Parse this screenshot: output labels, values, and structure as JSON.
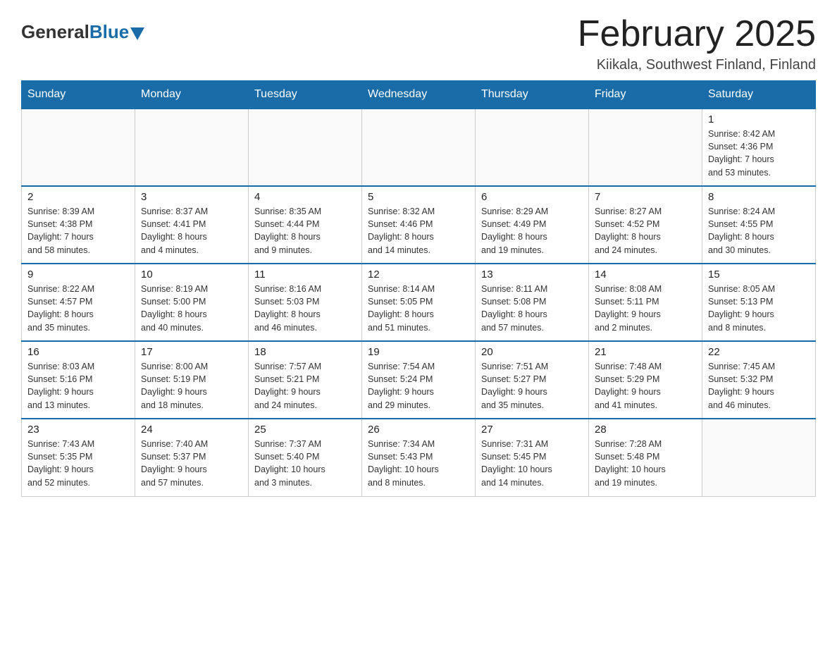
{
  "logo": {
    "general": "General",
    "blue": "Blue"
  },
  "title": {
    "month": "February 2025",
    "location": "Kiikala, Southwest Finland, Finland"
  },
  "weekdays": [
    "Sunday",
    "Monday",
    "Tuesday",
    "Wednesday",
    "Thursday",
    "Friday",
    "Saturday"
  ],
  "weeks": [
    [
      {
        "day": "",
        "info": ""
      },
      {
        "day": "",
        "info": ""
      },
      {
        "day": "",
        "info": ""
      },
      {
        "day": "",
        "info": ""
      },
      {
        "day": "",
        "info": ""
      },
      {
        "day": "",
        "info": ""
      },
      {
        "day": "1",
        "info": "Sunrise: 8:42 AM\nSunset: 4:36 PM\nDaylight: 7 hours\nand 53 minutes."
      }
    ],
    [
      {
        "day": "2",
        "info": "Sunrise: 8:39 AM\nSunset: 4:38 PM\nDaylight: 7 hours\nand 58 minutes."
      },
      {
        "day": "3",
        "info": "Sunrise: 8:37 AM\nSunset: 4:41 PM\nDaylight: 8 hours\nand 4 minutes."
      },
      {
        "day": "4",
        "info": "Sunrise: 8:35 AM\nSunset: 4:44 PM\nDaylight: 8 hours\nand 9 minutes."
      },
      {
        "day": "5",
        "info": "Sunrise: 8:32 AM\nSunset: 4:46 PM\nDaylight: 8 hours\nand 14 minutes."
      },
      {
        "day": "6",
        "info": "Sunrise: 8:29 AM\nSunset: 4:49 PM\nDaylight: 8 hours\nand 19 minutes."
      },
      {
        "day": "7",
        "info": "Sunrise: 8:27 AM\nSunset: 4:52 PM\nDaylight: 8 hours\nand 24 minutes."
      },
      {
        "day": "8",
        "info": "Sunrise: 8:24 AM\nSunset: 4:55 PM\nDaylight: 8 hours\nand 30 minutes."
      }
    ],
    [
      {
        "day": "9",
        "info": "Sunrise: 8:22 AM\nSunset: 4:57 PM\nDaylight: 8 hours\nand 35 minutes."
      },
      {
        "day": "10",
        "info": "Sunrise: 8:19 AM\nSunset: 5:00 PM\nDaylight: 8 hours\nand 40 minutes."
      },
      {
        "day": "11",
        "info": "Sunrise: 8:16 AM\nSunset: 5:03 PM\nDaylight: 8 hours\nand 46 minutes."
      },
      {
        "day": "12",
        "info": "Sunrise: 8:14 AM\nSunset: 5:05 PM\nDaylight: 8 hours\nand 51 minutes."
      },
      {
        "day": "13",
        "info": "Sunrise: 8:11 AM\nSunset: 5:08 PM\nDaylight: 8 hours\nand 57 minutes."
      },
      {
        "day": "14",
        "info": "Sunrise: 8:08 AM\nSunset: 5:11 PM\nDaylight: 9 hours\nand 2 minutes."
      },
      {
        "day": "15",
        "info": "Sunrise: 8:05 AM\nSunset: 5:13 PM\nDaylight: 9 hours\nand 8 minutes."
      }
    ],
    [
      {
        "day": "16",
        "info": "Sunrise: 8:03 AM\nSunset: 5:16 PM\nDaylight: 9 hours\nand 13 minutes."
      },
      {
        "day": "17",
        "info": "Sunrise: 8:00 AM\nSunset: 5:19 PM\nDaylight: 9 hours\nand 18 minutes."
      },
      {
        "day": "18",
        "info": "Sunrise: 7:57 AM\nSunset: 5:21 PM\nDaylight: 9 hours\nand 24 minutes."
      },
      {
        "day": "19",
        "info": "Sunrise: 7:54 AM\nSunset: 5:24 PM\nDaylight: 9 hours\nand 29 minutes."
      },
      {
        "day": "20",
        "info": "Sunrise: 7:51 AM\nSunset: 5:27 PM\nDaylight: 9 hours\nand 35 minutes."
      },
      {
        "day": "21",
        "info": "Sunrise: 7:48 AM\nSunset: 5:29 PM\nDaylight: 9 hours\nand 41 minutes."
      },
      {
        "day": "22",
        "info": "Sunrise: 7:45 AM\nSunset: 5:32 PM\nDaylight: 9 hours\nand 46 minutes."
      }
    ],
    [
      {
        "day": "23",
        "info": "Sunrise: 7:43 AM\nSunset: 5:35 PM\nDaylight: 9 hours\nand 52 minutes."
      },
      {
        "day": "24",
        "info": "Sunrise: 7:40 AM\nSunset: 5:37 PM\nDaylight: 9 hours\nand 57 minutes."
      },
      {
        "day": "25",
        "info": "Sunrise: 7:37 AM\nSunset: 5:40 PM\nDaylight: 10 hours\nand 3 minutes."
      },
      {
        "day": "26",
        "info": "Sunrise: 7:34 AM\nSunset: 5:43 PM\nDaylight: 10 hours\nand 8 minutes."
      },
      {
        "day": "27",
        "info": "Sunrise: 7:31 AM\nSunset: 5:45 PM\nDaylight: 10 hours\nand 14 minutes."
      },
      {
        "day": "28",
        "info": "Sunrise: 7:28 AM\nSunset: 5:48 PM\nDaylight: 10 hours\nand 19 minutes."
      },
      {
        "day": "",
        "info": ""
      }
    ]
  ]
}
